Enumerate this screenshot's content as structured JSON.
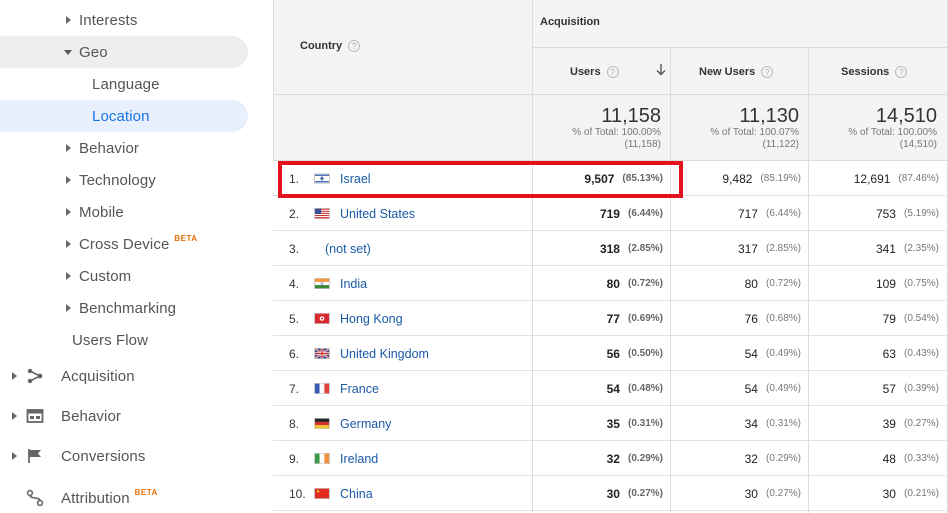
{
  "sidebar": {
    "sub_items": [
      {
        "label": "Interests",
        "expandable": true
      },
      {
        "label": "Geo",
        "expanded": true
      },
      {
        "label": "Language"
      },
      {
        "label": "Location",
        "active": true
      },
      {
        "label": "Behavior",
        "expandable": true
      },
      {
        "label": "Technology",
        "expandable": true
      },
      {
        "label": "Mobile",
        "expandable": true
      },
      {
        "label": "Cross Device",
        "badge": "BETA",
        "expandable": true
      },
      {
        "label": "Custom",
        "expandable": true
      },
      {
        "label": "Benchmarking",
        "expandable": true
      },
      {
        "label": "Users Flow"
      }
    ],
    "sections": [
      {
        "label": "Acquisition",
        "icon": "acquisition-icon"
      },
      {
        "label": "Behavior",
        "icon": "behavior-icon"
      },
      {
        "label": "Conversions",
        "icon": "flag-icon"
      },
      {
        "label": "Attribution",
        "icon": "attribution-icon",
        "badge": "BETA"
      }
    ]
  },
  "table": {
    "country_header": "Country",
    "group_header": "Acquisition",
    "columns": [
      "Users",
      "New Users",
      "Sessions"
    ],
    "totals": [
      {
        "value": "11,158",
        "pct": "% of Total: 100.00%",
        "base": "(11,158)"
      },
      {
        "value": "11,130",
        "pct": "% of Total: 100.07%",
        "base": "(11,122)"
      },
      {
        "value": "14,510",
        "pct": "% of Total: 100.00%",
        "base": "(14,510)"
      }
    ],
    "rows": [
      {
        "rank": "1.",
        "country": "Israel",
        "flag": "israel",
        "users": "9,507",
        "users_pct": "(85.13%)",
        "new_users": "9,482",
        "new_users_pct": "(85.19%)",
        "sessions": "12,691",
        "sessions_pct": "(87.46%)"
      },
      {
        "rank": "2.",
        "country": "United States",
        "flag": "us",
        "users": "719",
        "users_pct": "(6.44%)",
        "new_users": "717",
        "new_users_pct": "(6.44%)",
        "sessions": "753",
        "sessions_pct": "(5.19%)"
      },
      {
        "rank": "3.",
        "country": "(not set)",
        "flag": "",
        "users": "318",
        "users_pct": "(2.85%)",
        "new_users": "317",
        "new_users_pct": "(2.85%)",
        "sessions": "341",
        "sessions_pct": "(2.35%)"
      },
      {
        "rank": "4.",
        "country": "India",
        "flag": "india",
        "users": "80",
        "users_pct": "(0.72%)",
        "new_users": "80",
        "new_users_pct": "(0.72%)",
        "sessions": "109",
        "sessions_pct": "(0.75%)"
      },
      {
        "rank": "5.",
        "country": "Hong Kong",
        "flag": "hk",
        "users": "77",
        "users_pct": "(0.69%)",
        "new_users": "76",
        "new_users_pct": "(0.68%)",
        "sessions": "79",
        "sessions_pct": "(0.54%)"
      },
      {
        "rank": "6.",
        "country": "United Kingdom",
        "flag": "uk",
        "users": "56",
        "users_pct": "(0.50%)",
        "new_users": "54",
        "new_users_pct": "(0.49%)",
        "sessions": "63",
        "sessions_pct": "(0.43%)"
      },
      {
        "rank": "7.",
        "country": "France",
        "flag": "france",
        "users": "54",
        "users_pct": "(0.48%)",
        "new_users": "54",
        "new_users_pct": "(0.49%)",
        "sessions": "57",
        "sessions_pct": "(0.39%)"
      },
      {
        "rank": "8.",
        "country": "Germany",
        "flag": "germany",
        "users": "35",
        "users_pct": "(0.31%)",
        "new_users": "34",
        "new_users_pct": "(0.31%)",
        "sessions": "39",
        "sessions_pct": "(0.27%)"
      },
      {
        "rank": "9.",
        "country": "Ireland",
        "flag": "ireland",
        "users": "32",
        "users_pct": "(0.29%)",
        "new_users": "32",
        "new_users_pct": "(0.29%)",
        "sessions": "48",
        "sessions_pct": "(0.33%)"
      },
      {
        "rank": "10.",
        "country": "China",
        "flag": "china",
        "users": "30",
        "users_pct": "(0.27%)",
        "new_users": "30",
        "new_users_pct": "(0.27%)",
        "sessions": "30",
        "sessions_pct": "(0.21%)"
      }
    ]
  },
  "colors": {
    "link": "#1a5aa8",
    "active_nav": "#1a73e8",
    "highlight_box": "#e4121c",
    "beta_badge": "#e8710a"
  }
}
